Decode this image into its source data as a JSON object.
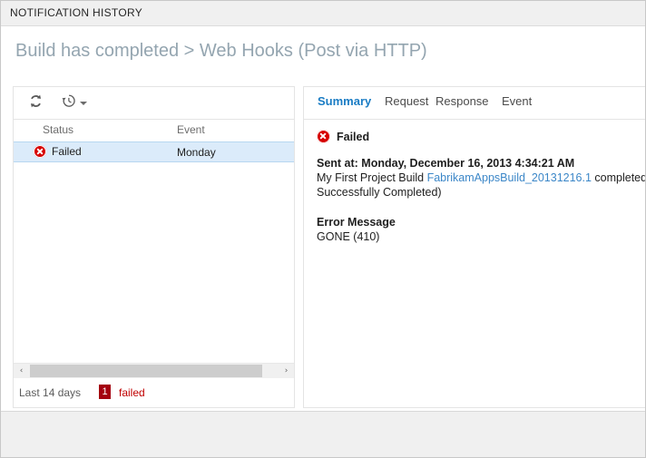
{
  "window": {
    "title": "NOTIFICATION HISTORY"
  },
  "header": {
    "breadcrumb": "Build has completed > Web Hooks (Post via HTTP)"
  },
  "left_panel": {
    "toolbar": {
      "refresh_icon": "refresh-icon",
      "history_icon": "history-clock-icon",
      "history_caret": "chevron-down-icon"
    },
    "columns": [
      "Status",
      "Event"
    ],
    "rows": [
      {
        "status_icon": "error-icon",
        "status": "Failed",
        "event": "Monday",
        "selected": true
      }
    ],
    "scrollbar": {
      "left_arrow": "‹",
      "right_arrow": "›"
    },
    "status_bar": {
      "range": "Last 14 days",
      "failed_count": "1",
      "failed_label": "failed",
      "badge_color": "#a4000f",
      "failed_text_color": "#c00000"
    }
  },
  "right_panel": {
    "tabs": [
      {
        "label": "Summary",
        "active": true
      },
      {
        "label": "Request",
        "active": false
      },
      {
        "label": "Response",
        "active": false
      },
      {
        "label": "Event",
        "active": false
      }
    ],
    "summary": {
      "status_icon": "error-icon",
      "status": "Failed",
      "sent_at": "Sent at: Monday, December 16, 2013 4:34:21 AM",
      "description_prefix": "My First Project Build ",
      "description_link": "FabrikamAppsBuild_20131216.1",
      "description_suffix": " completed (Status: Successfully Completed)",
      "error_heading": "Error Message",
      "error_text": "GONE (410)",
      "link_color": "#3c87c8"
    }
  },
  "colors": {
    "accent": "#1a7cc4",
    "title_text": "#94a5b0",
    "selection": "#dbebfa",
    "error": "#d60000"
  }
}
